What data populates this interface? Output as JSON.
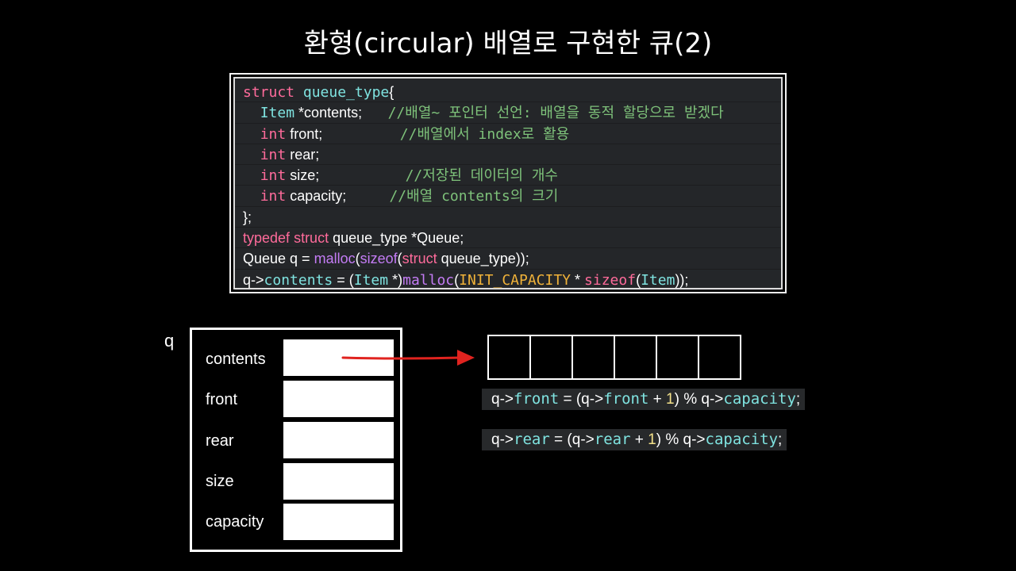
{
  "title": "환형(circular) 배열로 구현한 큐(2)",
  "code": {
    "l1": {
      "kw": "struct",
      "name": "queue_type",
      "brace": "{"
    },
    "l2": {
      "type": "Item",
      "rest": " *contents;",
      "comment": "//배열~ 포인터 선언: 배열을 동적 할당으로 받겠다"
    },
    "l3": {
      "type": "int",
      "rest": " front;",
      "comment": "//배열에서 index로 활용"
    },
    "l4": {
      "type": "int",
      "rest": " rear;"
    },
    "l5": {
      "type": "int",
      "rest": " size;",
      "comment": "//저장된 데이터의 개수"
    },
    "l6": {
      "type": "int",
      "rest": " capacity;",
      "comment": "//배열 contents의 크기"
    },
    "l7": {
      "text": "};"
    },
    "l8": {
      "kw1": "typedef",
      "kw2": "struct",
      "rest": " queue_type *Queue;"
    },
    "l9": {
      "a": "Queue q = ",
      "fn": "malloc",
      "b": "(",
      "fn2": "sizeof",
      "c": "(",
      "kw": "struct",
      "d": " queue_type));"
    },
    "l10": {
      "a": "q->",
      "field": "contents",
      "b": " = (",
      "type": "Item",
      "c": " *)",
      "fn": "malloc",
      "d": "(",
      "macro": "INIT_CAPACITY",
      "e": " * ",
      "fn2": "sizeof",
      "f": "(",
      "type2": "Item",
      "g": "));"
    }
  },
  "diagram": {
    "var_label": "q",
    "fields": [
      "contents",
      "front",
      "rear",
      "size",
      "capacity"
    ],
    "array_cells": 6
  },
  "exprs": {
    "front": {
      "a": "q->",
      "field": "front",
      "b": " = (q->",
      "field2": "front",
      "c": " + ",
      "num": "1",
      "d": ") % q->",
      "field3": "capacity",
      "e": ";"
    },
    "rear": {
      "a": "q->",
      "field": "rear",
      "b": " = (q->",
      "field2": "rear",
      "c": " + ",
      "num": "1",
      "d": ") % q->",
      "field3": "capacity",
      "e": ";"
    }
  },
  "colors": {
    "keyword": "#ff6b9b",
    "type": "#7fe3e0",
    "comment": "#7ec27a",
    "function": "#c47cf5",
    "macro": "#f0b239",
    "arrow": "#e0231f"
  }
}
